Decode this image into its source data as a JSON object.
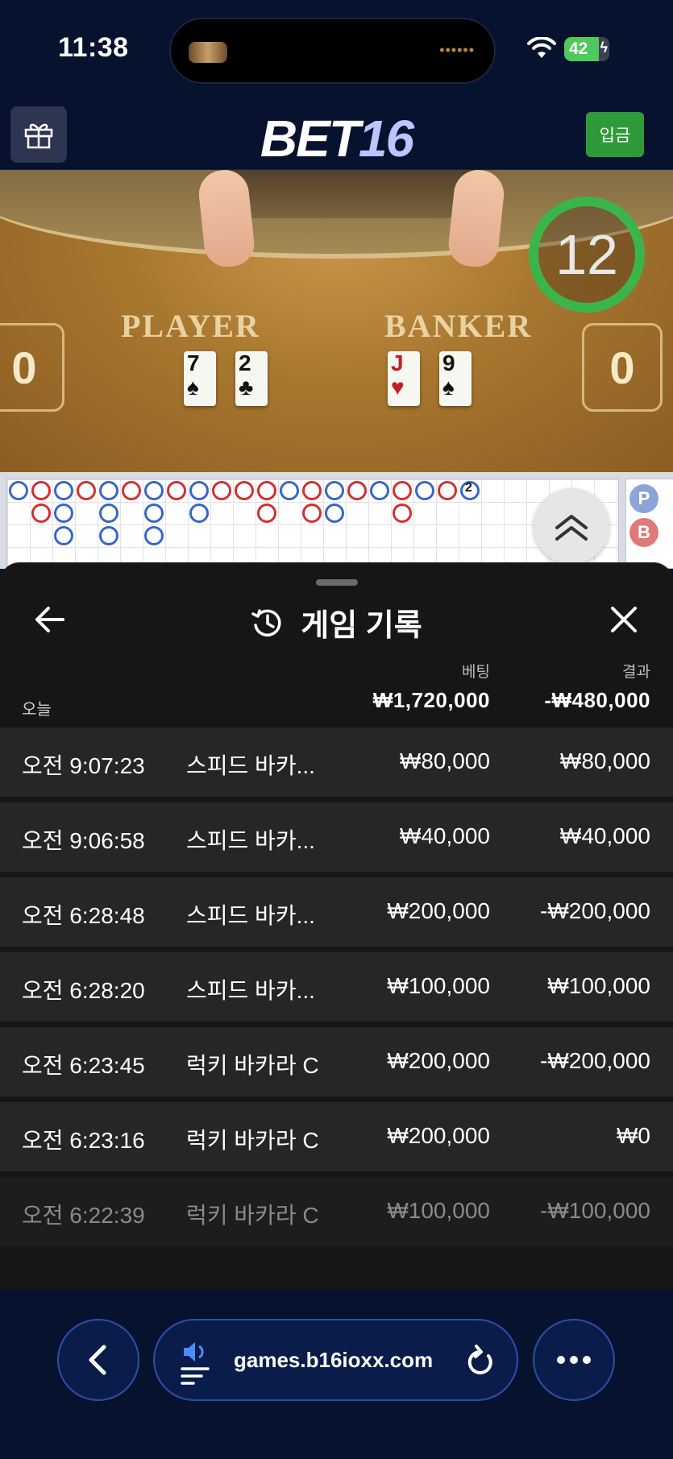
{
  "status_bar": {
    "time": "11:38",
    "battery": "42"
  },
  "header": {
    "logo_main": "BET",
    "logo_num": "16",
    "deposit_label": "입금"
  },
  "video": {
    "player_label": "PLAYER",
    "banker_label": "BANKER",
    "player_score": "0",
    "banker_score": "0",
    "timer": "12",
    "player_cards": [
      {
        "rank": "7",
        "suit": "♠",
        "color": "black"
      },
      {
        "rank": "2",
        "suit": "♣",
        "color": "black"
      }
    ],
    "banker_cards": [
      {
        "rank": "J",
        "suit": "♥",
        "color": "red"
      },
      {
        "rank": "9",
        "suit": "♠",
        "color": "black"
      }
    ],
    "roadmap_tie_count": "2",
    "side_labels": [
      "P",
      "B"
    ]
  },
  "sheet": {
    "title": "게임 기록",
    "col_bet": "베팅",
    "col_result": "결과",
    "today_label": "오늘",
    "today_bet": "₩1,720,000",
    "today_result": "-₩480,000",
    "rows": [
      {
        "time": "오전 9:07:23",
        "game": "스피드 바카...",
        "bet": "₩80,000",
        "result": "₩80,000"
      },
      {
        "time": "오전 9:06:58",
        "game": "스피드 바카...",
        "bet": "₩40,000",
        "result": "₩40,000"
      },
      {
        "time": "오전 6:28:48",
        "game": "스피드 바카...",
        "bet": "₩200,000",
        "result": "-₩200,000"
      },
      {
        "time": "오전 6:28:20",
        "game": "스피드 바카...",
        "bet": "₩100,000",
        "result": "₩100,000"
      },
      {
        "time": "오전 6:23:45",
        "game": "럭키 바카라 C",
        "bet": "₩200,000",
        "result": "-₩200,000"
      },
      {
        "time": "오전 6:23:16",
        "game": "럭키 바카라 C",
        "bet": "₩200,000",
        "result": "₩0"
      },
      {
        "time": "오전 6:22:39",
        "game": "럭키 바카라 C",
        "bet": "₩100,000",
        "result": "-₩100,000"
      }
    ]
  },
  "browser": {
    "url": "games.b16ioxx.com"
  },
  "colors": {
    "accent_green": "#2e9a3a",
    "banker_red": "#d32f2f",
    "player_blue": "#3966c6"
  }
}
